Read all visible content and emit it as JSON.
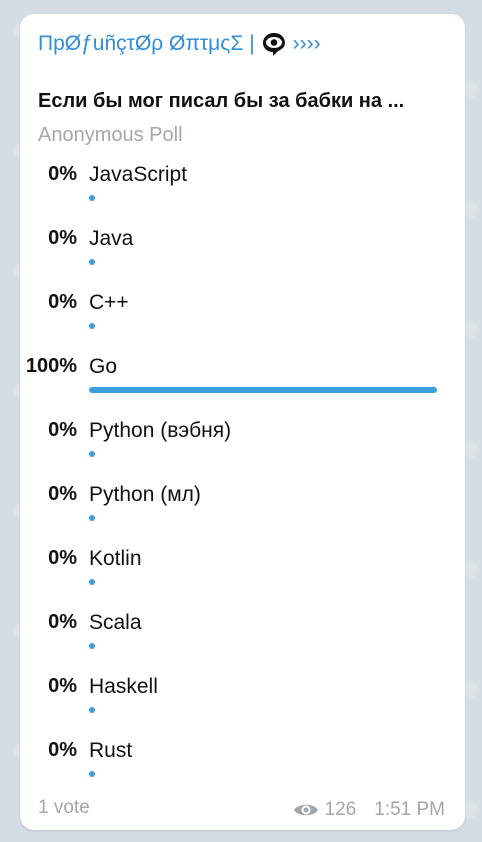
{
  "message": {
    "sender": "ПрØƒuñçτØρ ØπτμςΣ |",
    "sender_suffix": "››››",
    "question": "Если бы мог писал бы за бабки на ...",
    "poll_type": "Anonymous Poll",
    "options": [
      {
        "percent_text": "0%",
        "label": "JavaScript",
        "fraction": 0
      },
      {
        "percent_text": "0%",
        "label": "Java",
        "fraction": 0
      },
      {
        "percent_text": "0%",
        "label": "C++",
        "fraction": 0
      },
      {
        "percent_text": "100%",
        "label": "Go",
        "fraction": 1
      },
      {
        "percent_text": "0%",
        "label": "Python (вэбня)",
        "fraction": 0
      },
      {
        "percent_text": "0%",
        "label": "Python (мл)",
        "fraction": 0
      },
      {
        "percent_text": "0%",
        "label": "Kotlin",
        "fraction": 0
      },
      {
        "percent_text": "0%",
        "label": "Scala",
        "fraction": 0
      },
      {
        "percent_text": "0%",
        "label": "Haskell",
        "fraction": 0
      },
      {
        "percent_text": "0%",
        "label": "Rust",
        "fraction": 0
      }
    ],
    "votes_text": "1 vote",
    "views": "126",
    "time": "1:51 PM"
  },
  "colors": {
    "accent": "#2f8ed6",
    "bar": "#3a9fdc",
    "muted": "#a0a7ae",
    "background": "#d5dde4"
  },
  "icons": {
    "sender_emoji": "eye-in-speech-bubble-icon",
    "views": "eye-icon"
  }
}
